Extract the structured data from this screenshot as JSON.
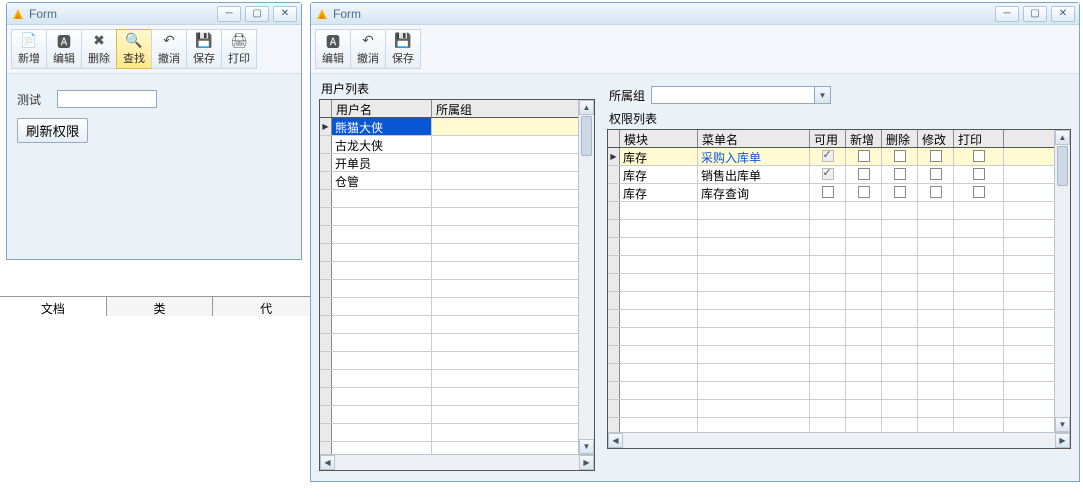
{
  "win1": {
    "title": "Form",
    "toolbar": [
      {
        "key": "new",
        "label": "新增",
        "icon": "📄"
      },
      {
        "key": "edit",
        "label": "编辑",
        "icon": "🅰"
      },
      {
        "key": "delete",
        "label": "删除",
        "icon": "✖"
      },
      {
        "key": "search",
        "label": "查找",
        "icon": "🔍",
        "active": true
      },
      {
        "key": "undo",
        "label": "撤消",
        "icon": "↶"
      },
      {
        "key": "save",
        "label": "保存",
        "icon": "💾"
      },
      {
        "key": "print",
        "label": "打印",
        "icon": "🖨"
      }
    ],
    "test_label": "测试",
    "test_value": "",
    "refresh_btn": "刷新权限"
  },
  "tabs": [
    {
      "key": "doc",
      "label": "文档",
      "active": true
    },
    {
      "key": "class",
      "label": "类",
      "active": false
    },
    {
      "key": "code",
      "label": "代",
      "active": false
    }
  ],
  "win2": {
    "title": "Form",
    "toolbar": [
      {
        "key": "edit",
        "label": "编辑",
        "icon": "🅰"
      },
      {
        "key": "undo",
        "label": "撤消",
        "icon": "↶"
      },
      {
        "key": "save",
        "label": "保存",
        "icon": "💾"
      }
    ],
    "userlist_label": "用户列表",
    "user_cols": {
      "name": "用户名",
      "group": "所属组"
    },
    "users": [
      {
        "name": "熊猫大侠",
        "group": "",
        "selected": true
      },
      {
        "name": "古龙大侠",
        "group": ""
      },
      {
        "name": "开单员",
        "group": ""
      },
      {
        "name": "仓管",
        "group": ""
      }
    ],
    "group_label": "所属组",
    "group_value": "",
    "permlist_label": "权限列表",
    "perm_cols": {
      "module": "模块",
      "menu": "菜单名",
      "avail": "可用",
      "new": "新增",
      "del": "删除",
      "mod": "修改",
      "print": "打印"
    },
    "perms": [
      {
        "module": "库存",
        "menu": "采购入库单",
        "avail": true,
        "avail_disabled": true,
        "highlight": true,
        "first": true
      },
      {
        "module": "库存",
        "menu": "销售出库单",
        "avail": true,
        "avail_disabled": true
      },
      {
        "module": "库存",
        "menu": "库存查询",
        "avail": false
      }
    ]
  }
}
